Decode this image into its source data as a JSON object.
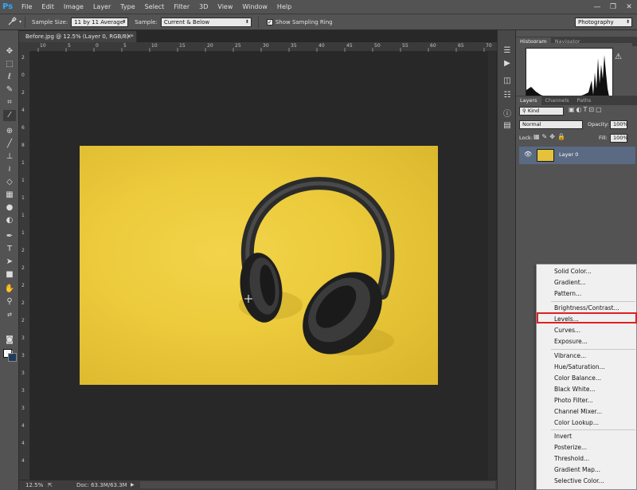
{
  "app": {
    "logo": "Ps"
  },
  "menu": [
    "File",
    "Edit",
    "Image",
    "Layer",
    "Type",
    "Select",
    "Filter",
    "3D",
    "View",
    "Window",
    "Help"
  ],
  "window_controls": [
    "—",
    "❐",
    "✕"
  ],
  "options_bar": {
    "sample_size_label": "Sample Size:",
    "sample_size_value": "11 by 11 Average",
    "sample_label": "Sample:",
    "sample_value": "Current & Below",
    "show_ring_label": "Show Sampling Ring",
    "workspace_value": "Photography"
  },
  "document": {
    "tab_title": "Before.jpg @ 12.5% (Layer 0, RGB/8) *",
    "close": "✕",
    "ruler_h": [
      "10",
      "5",
      "0",
      "5",
      "10",
      "15",
      "20",
      "25",
      "30",
      "35",
      "40",
      "45",
      "50",
      "55",
      "60",
      "65",
      "70"
    ],
    "ruler_v": [
      "2",
      "0",
      "2",
      "4",
      "6",
      "8",
      "1",
      "1",
      "1",
      "1",
      "1",
      "2",
      "2",
      "2",
      "2",
      "2",
      "3",
      "3",
      "3",
      "3",
      "3",
      "4",
      "4",
      "4",
      "4"
    ]
  },
  "status": {
    "zoom": "12.5%",
    "doc": "Doc: 63.3M/63.3M"
  },
  "panels": {
    "top_tabs": [
      "Histogram",
      "Navigator"
    ],
    "histogram_warning": "⚠",
    "layer_tabs": [
      "Layers",
      "Channels",
      "Paths"
    ],
    "kind_label": "Kind",
    "blend_mode": "Normal",
    "opacity_label": "Opacity:",
    "opacity_value": "100%",
    "lock_label": "Lock:",
    "fill_label": "Fill:",
    "fill_value": "100%",
    "layer_name": "Layer 0"
  },
  "context_menu": {
    "group1": [
      "Solid Color...",
      "Gradient...",
      "Pattern..."
    ],
    "group2": [
      "Brightness/Contrast...",
      "Levels...",
      "Curves...",
      "Exposure..."
    ],
    "group3": [
      "Vibrance...",
      "Hue/Saturation...",
      "Color Balance...",
      "Black  White...",
      "Photo Filter...",
      "Channel Mixer...",
      "Color Lookup..."
    ],
    "group4": [
      "Invert",
      "Posterize...",
      "Threshold...",
      "Gradient Map...",
      "Selective Color..."
    ],
    "highlighted": "Levels..."
  },
  "colors": {
    "highlight": "#e02020",
    "foreground": "#ffffff",
    "background": "#1f3b5a"
  }
}
